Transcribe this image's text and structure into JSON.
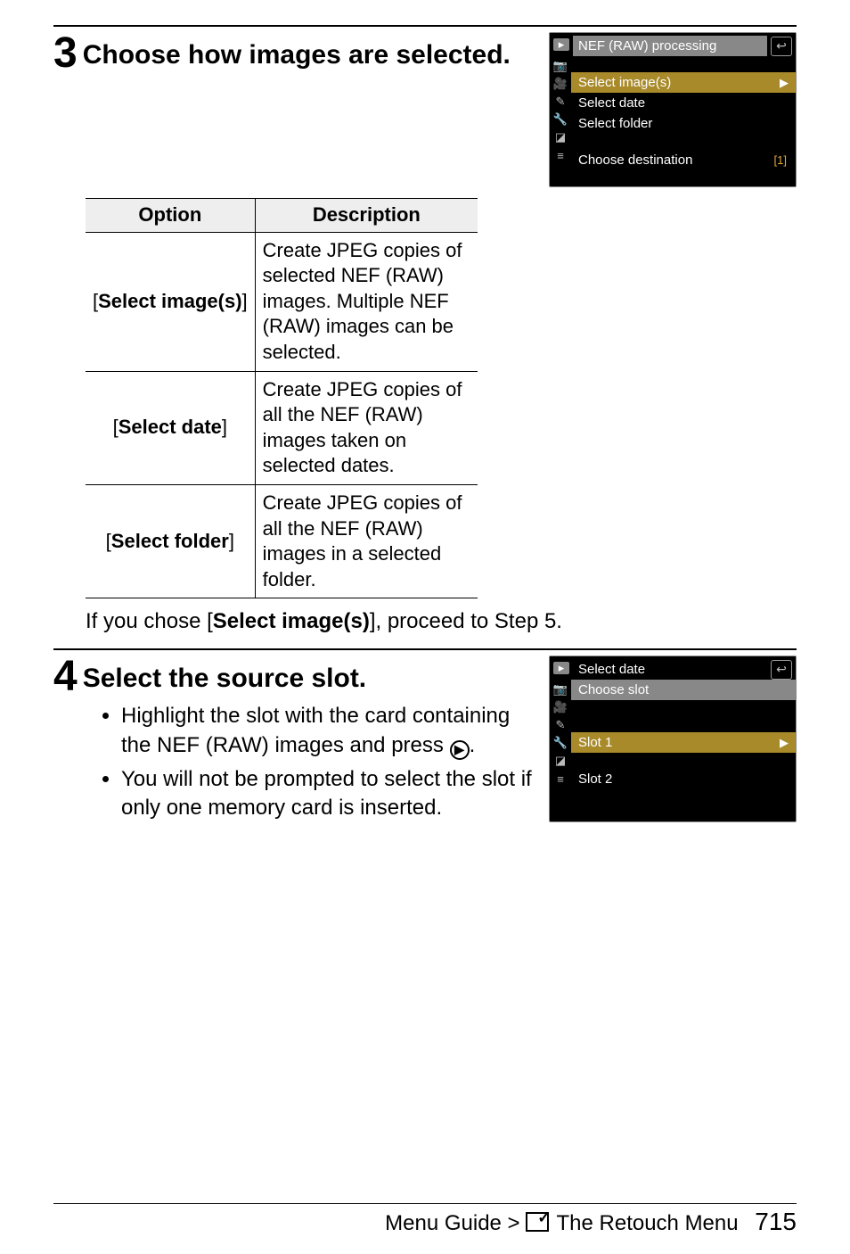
{
  "step3": {
    "num": "3",
    "title": "Choose how images are selected.",
    "table": {
      "headers": [
        "Option",
        "Description"
      ],
      "rows": [
        {
          "label_pre": "[",
          "label_bold": "Select image(s)",
          "label_post": "]",
          "desc": "Create JPEG copies of selected NEF (RAW) images. Multiple NEF (RAW) images can be selected."
        },
        {
          "label_pre": "[",
          "label_bold": "Select date",
          "label_post": "]",
          "desc": "Create JPEG copies of all the NEF (RAW) images taken on selected dates."
        },
        {
          "label_pre": "[",
          "label_bold": "Select folder",
          "label_post": "]",
          "desc": "Create JPEG copies of all the NEF (RAW) images in a selected folder."
        }
      ]
    },
    "note_pre": "If you chose [",
    "note_bold": "Select image(s)",
    "note_post": "], proceed to Step 5.",
    "screen": {
      "title": "NEF (RAW) processing",
      "rows": [
        {
          "label": "Select image(s)",
          "highlight": true,
          "chevron": true
        },
        {
          "label": "Select date"
        },
        {
          "label": "Select folder"
        }
      ],
      "dest": "Choose destination",
      "dest_icon": "[1]"
    }
  },
  "step4": {
    "num": "4",
    "title": "Select the source slot.",
    "bullets": [
      {
        "pre": "Highlight the slot with the card containing the NEF (RAW) images and press ",
        "icon": "▶",
        "post": "."
      },
      {
        "pre": "You will not be prompted to select the slot if only one memory card is inserted.",
        "icon": "",
        "post": ""
      }
    ],
    "screen": {
      "title": "Select date",
      "sub": "Choose slot",
      "slot1": "Slot 1",
      "slot2": "Slot 2"
    }
  },
  "footer": {
    "text": "Menu Guide > ",
    "section": " The Retouch Menu",
    "page": "715"
  }
}
